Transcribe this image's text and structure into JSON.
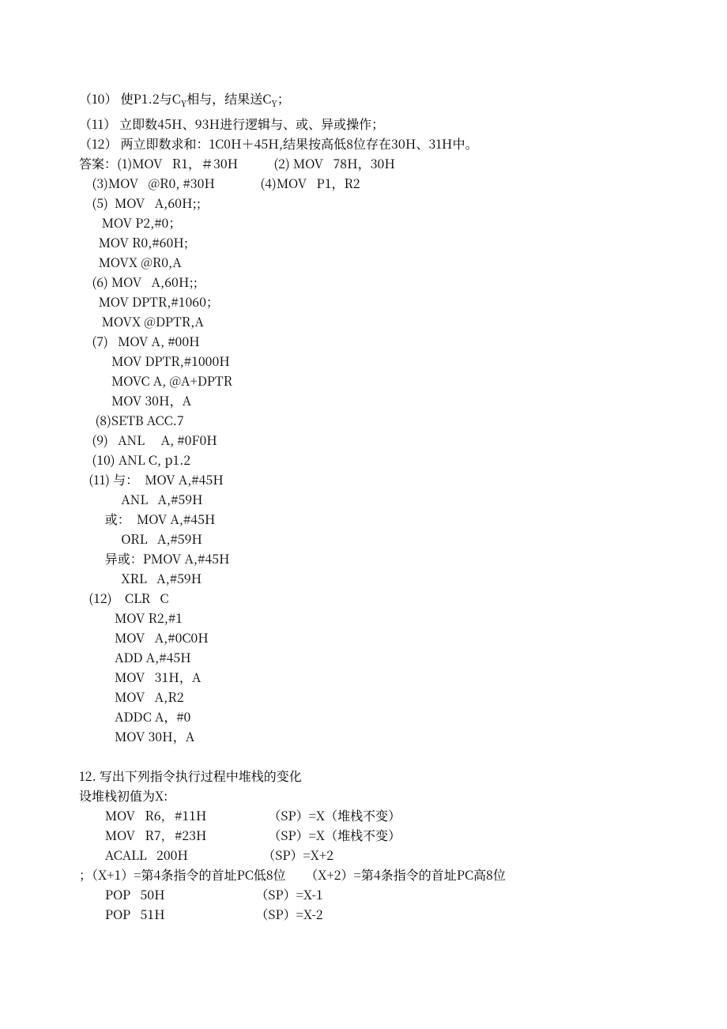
{
  "lines": {
    "l10": "（10） 使P1.2与C",
    "l10b": "相与，结果送C",
    "l10c": "；",
    "l11": "（11） 立即数45H、93H进行逻辑与、或、异或操作；",
    "l12": "（12） 两立即数求和：1C0H＋45H,结果按高低8位存在30H、31H中。",
    "ans1": "答案：(1)MOV   R1，＃30H           (2) MOV   78H，30H",
    "a3": "    (3)MOV   @R0, #30H              (4)MOV   P1，R2",
    "a5a": "    (5)  MOV   A,60H;;",
    "a5b": "       MOV P2,#0；",
    "a5c": "      MOV R0,#60H;",
    "a5d": "      MOVX @R0,A",
    "a6a": "    (6) MOV   A,60H;;",
    "a6b": "      MOV DPTR,#1060；",
    "a6c": "       MOVX @DPTR,A",
    "a7a": "    (7)   MOV A, #00H",
    "a7b": "          MOV DPTR,#1000H",
    "a7c": "          MOVC A, @A+DPTR",
    "a7d": "          MOV 30H，A",
    "a8": "     (8)SETB ACC.7",
    "a9": "    (9)   ANL     A, #0F0H",
    "a10": "    (10) ANL C, p1.2",
    "a11a": "   (11) 与：  MOV A,#45H",
    "a11b": "             ANL   A,#59H",
    "a11c": "        或：  MOV A,#45H",
    "a11d": "             ORL   A,#59H",
    "a11e": "        异或：PMOV A,#45H",
    "a11f": "             XRL   A,#59H",
    "a12a": "   (12)    CLR   C",
    "a12b": "           MOV R2,#1",
    "a12c": "           MOV   A,#0C0H",
    "a12d": "           ADD A,#45H",
    "a12e": "           MOV   31H，A",
    "a12f": "           MOV   A,R2",
    "a12g": "           ADDC A，#0",
    "a12h": "           MOV 30H，A",
    "q12": "12. 写出下列指令执行过程中堆栈的变化",
    "p0": "设堆栈初值为X:",
    "p1": "        MOV   R6,   #11H                   （SP）=X（堆栈不变）",
    "p2": "        MOV   R7,   #23H                   （SP）=X（堆栈不变）",
    "p3": "        ACALL   200H                       （SP）=X+2",
    "p4": "；（X+1）=第4条指令的首址PC低8位      （X+2）=第4条指令的首址PC高8位",
    "p5": "        POP   50H                            （SP）=X-1",
    "p6": "        POP   51H                            （SP）=X-2"
  },
  "sub": "Y"
}
